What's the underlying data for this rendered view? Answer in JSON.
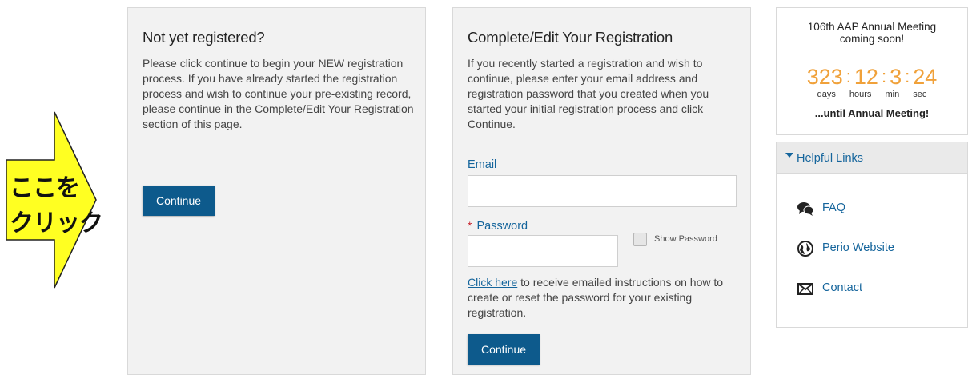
{
  "annotation": {
    "line1": "ここを",
    "line2": "クリック"
  },
  "new_registration": {
    "title": "Not yet registered?",
    "text": "Please click continue to begin your NEW registration process.  If you have already started the registration process and wish to continue your pre-existing record, please continue in the Complete/Edit Your Registration section of this page.",
    "continue_label": "Continue"
  },
  "edit_registration": {
    "title": "Complete/Edit Your Registration",
    "text": "If you recently started a registration and wish to continue, please enter your email address and registration password that you created when you started your initial registration process and click Continue.",
    "email_label": "Email",
    "email_value": "",
    "password_required_mark": "*",
    "password_label": "Password",
    "password_value": "",
    "show_password_label": "Show Password",
    "reset_link": "Click here",
    "reset_text": " to receive emailed instructions on how to create or reset the password for your existing registration.",
    "continue_label": "Continue"
  },
  "countdown": {
    "title_line1": "106th AAP Annual Meeting",
    "title_line2": "coming soon!",
    "days": "323",
    "hours": "12",
    "minutes": "3",
    "seconds": "24",
    "sep": ":",
    "unit_days": "days",
    "unit_hours": "hours",
    "unit_min": "min",
    "unit_sec": "sec",
    "until": "...until Annual Meeting!",
    "number_color": "#f0a13a"
  },
  "helpful_links": {
    "title": "Helpful Links",
    "items": [
      {
        "label": "FAQ",
        "icon": "chat-bubbles-icon"
      },
      {
        "label": "Perio Website",
        "icon": "globe-icon"
      },
      {
        "label": "Contact",
        "icon": "envelope-icon"
      }
    ]
  },
  "colors": {
    "accent": "#15659c",
    "button": "#0d5a8c",
    "required": "#c7212b",
    "arrow_fill": "#ffff22"
  }
}
